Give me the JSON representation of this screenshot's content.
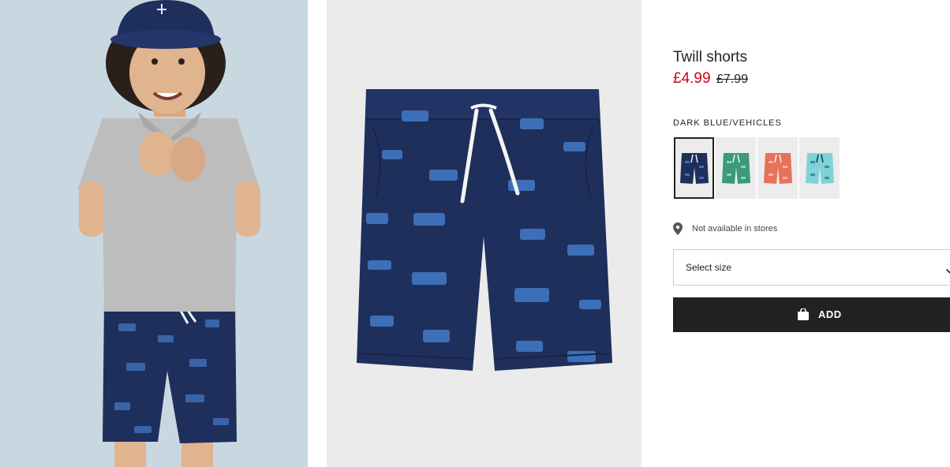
{
  "product": {
    "title": "Twill shorts",
    "price_sale": "£4.99",
    "price_original": "£7.99"
  },
  "color": {
    "label": "DARK BLUE/VEHICLES",
    "swatches": [
      {
        "name": "dark blue vehicles",
        "fill": "#1f2f5c",
        "pattern": "#3d6fb8",
        "selected": true
      },
      {
        "name": "green print",
        "fill": "#3a9a7a",
        "pattern": "#8fd0b2",
        "selected": false
      },
      {
        "name": "coral print",
        "fill": "#e8715a",
        "pattern": "#f4b6a4",
        "selected": false
      },
      {
        "name": "turquoise print",
        "fill": "#7fd3d6",
        "pattern": "#3a8f9a",
        "selected": false
      }
    ]
  },
  "availability": {
    "text": "Not available in stores",
    "icon": "location-pin-icon"
  },
  "size_select": {
    "label": "Select size",
    "icon": "chevron-down-icon"
  },
  "add_button": {
    "label": "ADD",
    "icon": "shopping-bag-icon"
  },
  "colors": {
    "sale_price": "#d0021b",
    "button_bg": "#222222",
    "shorts": "#1f2f5c",
    "print": "#3d6fb8"
  }
}
